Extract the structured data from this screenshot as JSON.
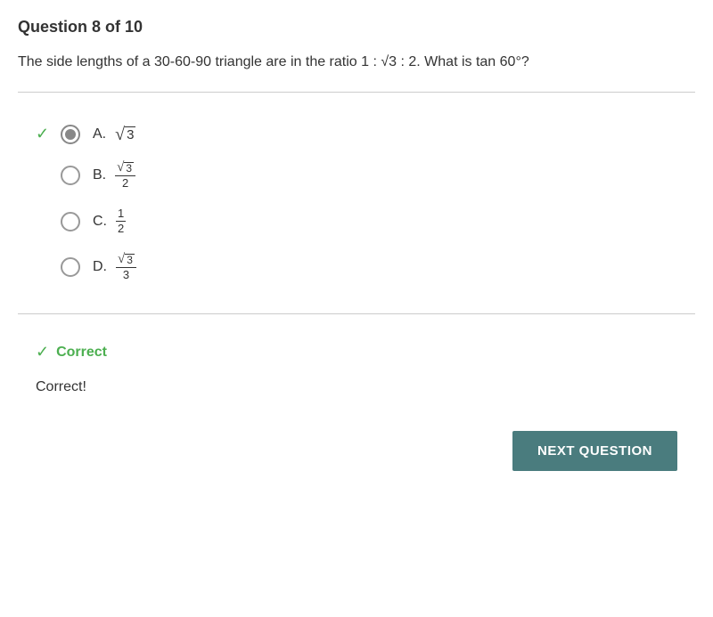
{
  "header": {
    "question_progress": "Question 8 of 10"
  },
  "question": {
    "text_before": "The side lengths of a 30-60-90 triangle are in the ratio 1 : ",
    "text_middle": "3",
    "text_after": " : 2. What is tan 60°?"
  },
  "options": [
    {
      "id": "A",
      "label": "A.",
      "value_type": "sqrt",
      "value": "3",
      "selected": true,
      "correct": true
    },
    {
      "id": "B",
      "label": "B.",
      "value_type": "frac-sqrt",
      "numerator": "3",
      "denominator": "2",
      "selected": false,
      "correct": false
    },
    {
      "id": "C",
      "label": "C.",
      "value_type": "frac",
      "numerator": "1",
      "denominator": "2",
      "selected": false,
      "correct": false
    },
    {
      "id": "D",
      "label": "D.",
      "value_type": "frac-sqrt",
      "numerator": "3",
      "denominator": "3",
      "selected": false,
      "correct": false
    }
  ],
  "result": {
    "status": "Correct",
    "message": "Correct!"
  },
  "buttons": {
    "next_label": "NEXT QUESTION"
  },
  "colors": {
    "correct_green": "#4caf50",
    "button_teal": "#4a7c7e"
  }
}
